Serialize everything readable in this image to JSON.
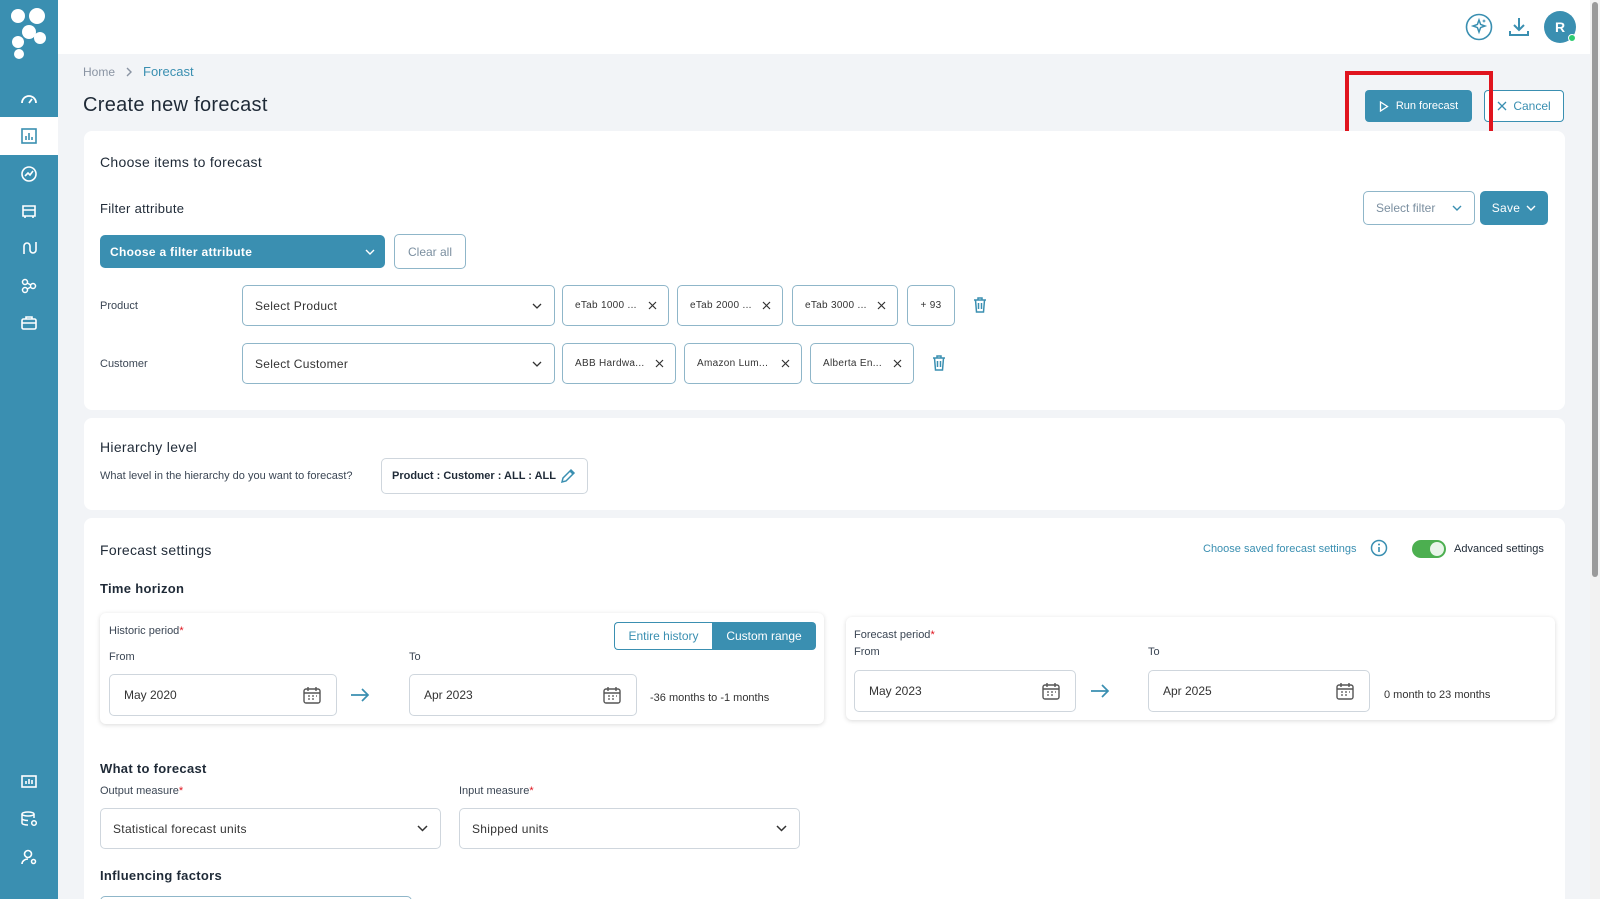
{
  "sidebar": {
    "items": [
      {
        "icon": "dashboard-icon"
      },
      {
        "icon": "forecast-chart-icon",
        "active": true
      },
      {
        "icon": "analytics-icon"
      },
      {
        "icon": "inventory-icon"
      },
      {
        "icon": "flow-icon"
      },
      {
        "icon": "network-icon"
      },
      {
        "icon": "briefcase-icon"
      },
      {
        "icon": "reports-icon"
      },
      {
        "icon": "database-settings-icon"
      },
      {
        "icon": "user-settings-icon"
      }
    ]
  },
  "topbar": {
    "avatar_initial": "R"
  },
  "breadcrumb": {
    "home": "Home",
    "current": "Forecast"
  },
  "page": {
    "title": "Create new forecast"
  },
  "actions": {
    "run_label": "Run forecast",
    "cancel_label": "Cancel"
  },
  "items_card": {
    "title": "Choose items to forecast",
    "filter_label": "Filter attribute",
    "select_filter": "Select filter",
    "save_label": "Save",
    "choose_filter": "Choose a filter attribute",
    "clear_all": "Clear all",
    "rows": [
      {
        "label": "Product",
        "placeholder": "Select Product",
        "chips": [
          "eTab 1000 ...",
          "eTab 2000 ...",
          "eTab 3000 ..."
        ],
        "more": "+ 93"
      },
      {
        "label": "Customer",
        "placeholder": "Select Customer",
        "chips": [
          "ABB Hardwa...",
          "Amazon Lum...",
          "Alberta En..."
        ]
      }
    ]
  },
  "hierarchy": {
    "title": "Hierarchy level",
    "question": "What level in the hierarchy do you want to forecast?",
    "value": "Product : Customer : ALL : ALL"
  },
  "forecast_settings": {
    "title": "Forecast settings",
    "saved_link": "Choose saved forecast settings",
    "advanced_label": "Advanced settings",
    "advanced_on": true,
    "time_horizon": "Time horizon",
    "historic": {
      "label": "Historic period",
      "from_label": "From",
      "to_label": "To",
      "from": "May 2020",
      "to": "Apr 2023",
      "range": "-36 months to -1 months",
      "tabs": [
        "Entire history",
        "Custom range"
      ],
      "selected_tab": "Custom range"
    },
    "forecast": {
      "label": "Forecast period",
      "from_label": "From",
      "to_label": "To",
      "from": "May 2023",
      "to": "Apr 2025",
      "range": "0 month to 23 months"
    },
    "what_to_forecast": "What to forecast",
    "output_label": "Output measure",
    "output_value": "Statistical forecast units",
    "input_label": "Input measure",
    "input_value": "Shipped units",
    "influencing": "Influencing factors"
  },
  "colors": {
    "brand": "#3a8fb1",
    "highlight": "#e0141e",
    "toggle_on": "#4caf50"
  }
}
